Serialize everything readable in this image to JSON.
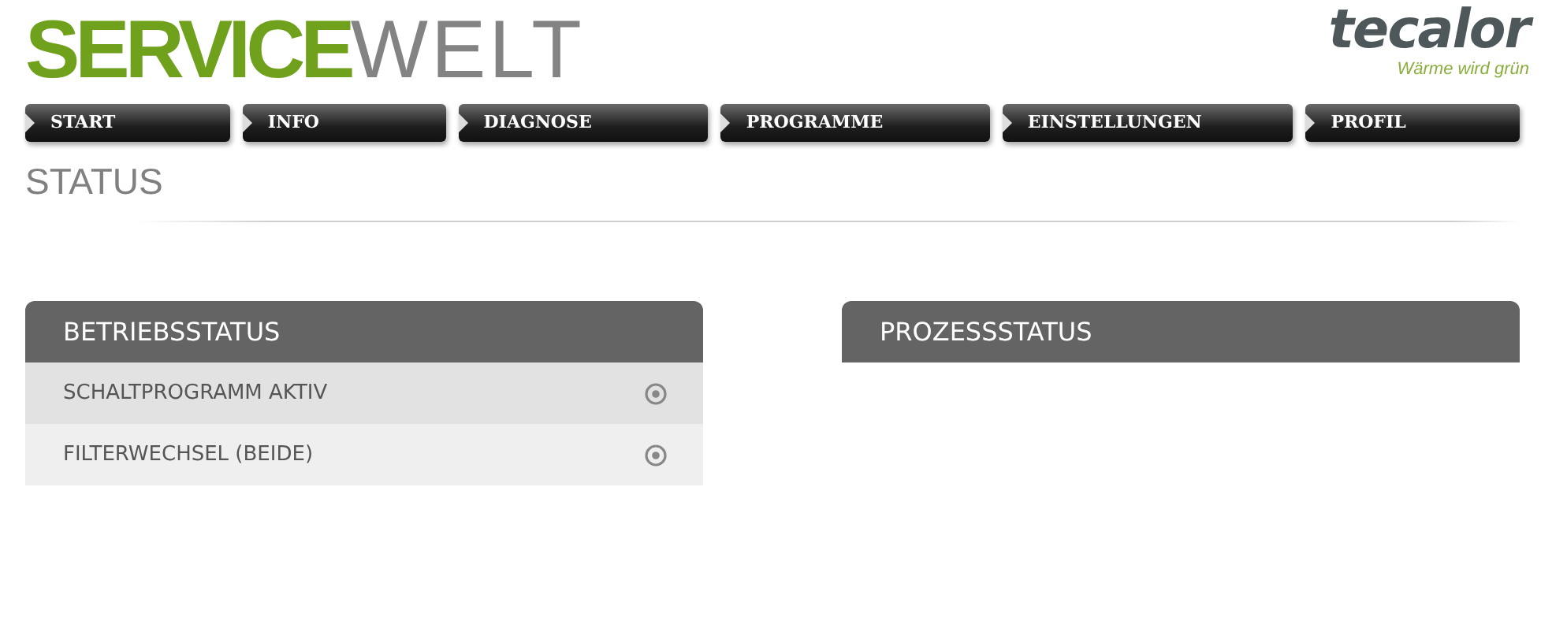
{
  "brand": {
    "primary": "SERVICE",
    "secondary": "WELT"
  },
  "logo": {
    "name": "tecalor",
    "tagline": "Wärme wird grün"
  },
  "nav": [
    {
      "label": "START"
    },
    {
      "label": "INFO"
    },
    {
      "label": "DIAGNOSE"
    },
    {
      "label": "PROGRAMME"
    },
    {
      "label": "EINSTELLUNGEN"
    },
    {
      "label": "PROFIL"
    }
  ],
  "page_title": "STATUS",
  "panels": [
    {
      "title": "BETRIEBSSTATUS",
      "rows": [
        {
          "label": "SCHALTPROGRAMM AKTIV"
        },
        {
          "label": "FILTERWECHSEL (BEIDE)"
        }
      ]
    },
    {
      "title": "PROZESSSTATUS"
    }
  ]
}
